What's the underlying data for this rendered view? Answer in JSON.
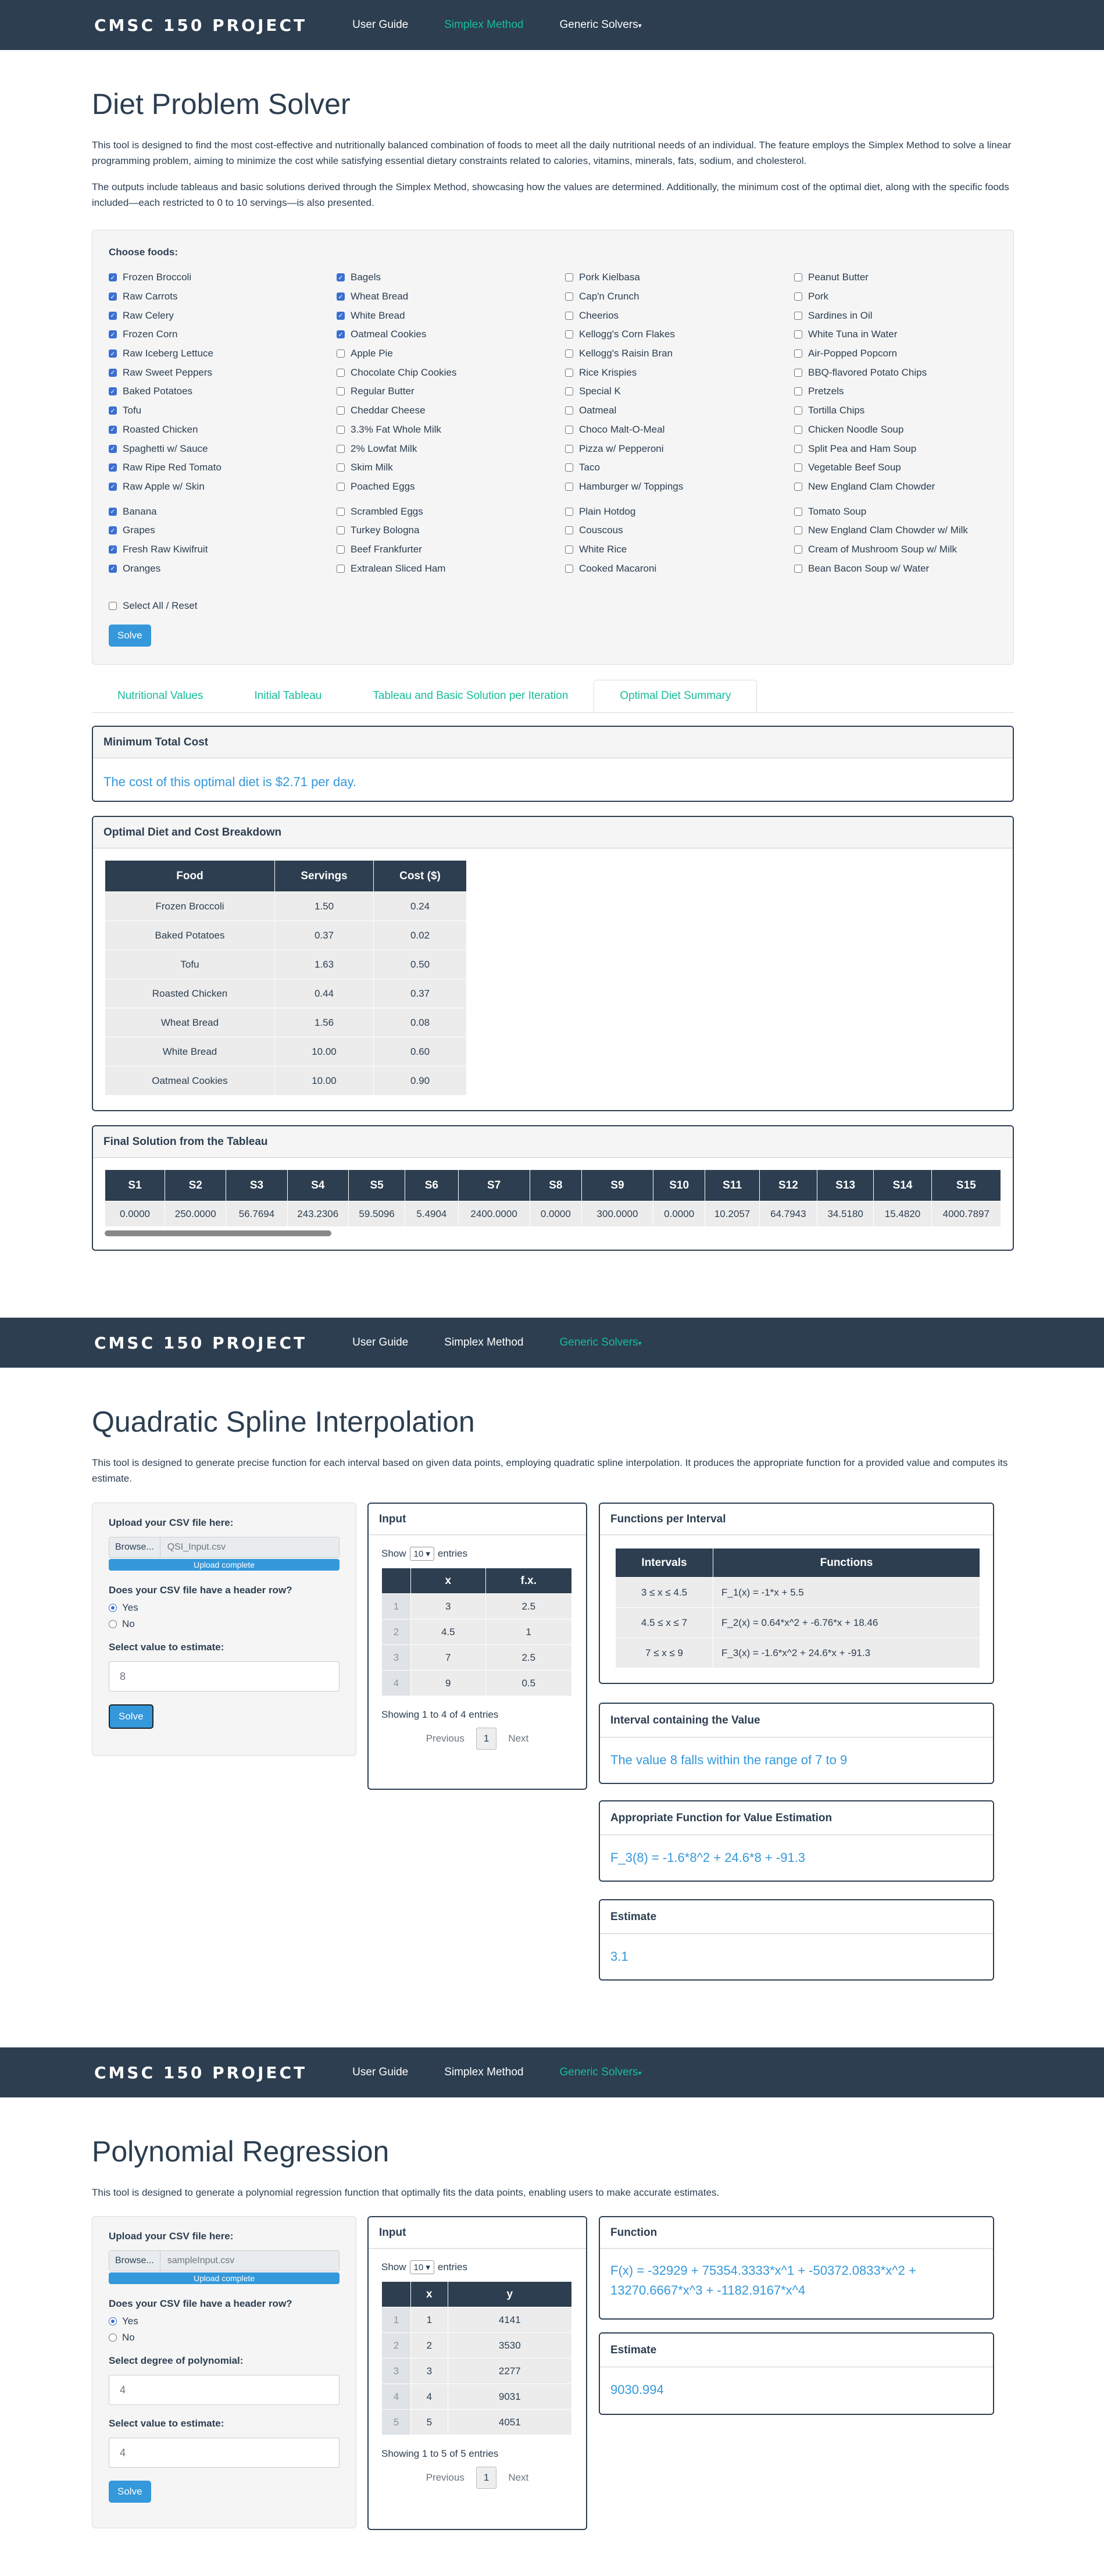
{
  "brand": "CMSC 150 PROJECT",
  "nav": {
    "user_guide": "User Guide",
    "simplex": "Simplex Method",
    "generic": "Generic Solvers"
  },
  "diet": {
    "title": "Diet Problem Solver",
    "p1": "This tool is designed to find the most cost-effective and nutritionally balanced combination of foods to meet all the daily nutritional needs of an individual. The feature employs the Simplex Method to solve a linear programming problem, aiming to minimize the cost while satisfying essential dietary constraints related to calories, vitamins, minerals, fats, sodium, and cholesterol.",
    "p2": "The outputs include tableaus and basic solutions derived through the Simplex Method, showcasing how the values are determined. Additionally, the minimum cost of the optimal diet, along with the specific foods included—each restricted to 0 to 10 servings—is also presented.",
    "choose": "Choose foods:",
    "columns": [
      {
        "items": [
          {
            "label": "Frozen Broccoli",
            "checked": true
          },
          {
            "label": "Raw Carrots",
            "checked": true
          },
          {
            "label": "Raw Celery",
            "checked": true
          },
          {
            "label": "Frozen Corn",
            "checked": true
          },
          {
            "label": "Raw Iceberg Lettuce",
            "checked": true
          },
          {
            "label": "Raw Sweet Peppers",
            "checked": true
          },
          {
            "label": "Baked Potatoes",
            "checked": true
          },
          {
            "label": "Tofu",
            "checked": true
          },
          {
            "label": "Roasted Chicken",
            "checked": true
          },
          {
            "label": "Spaghetti w/ Sauce",
            "checked": true
          },
          {
            "label": "Raw Ripe Red Tomato",
            "checked": true
          },
          {
            "label": "Raw Apple w/ Skin",
            "checked": true
          },
          {
            "label": "Banana",
            "checked": true
          },
          {
            "label": "Grapes",
            "checked": true
          },
          {
            "label": "Fresh Raw Kiwifruit",
            "checked": true
          },
          {
            "label": "Oranges",
            "checked": true
          }
        ]
      },
      {
        "items": [
          {
            "label": "Bagels",
            "checked": true
          },
          {
            "label": "Wheat Bread",
            "checked": true
          },
          {
            "label": "White Bread",
            "checked": true
          },
          {
            "label": "Oatmeal Cookies",
            "checked": true
          },
          {
            "label": "Apple Pie",
            "checked": false
          },
          {
            "label": "Chocolate Chip Cookies",
            "checked": false
          },
          {
            "label": "Regular Butter",
            "checked": false
          },
          {
            "label": "Cheddar Cheese",
            "checked": false
          },
          {
            "label": "3.3% Fat Whole Milk",
            "checked": false
          },
          {
            "label": "2% Lowfat Milk",
            "checked": false
          },
          {
            "label": "Skim Milk",
            "checked": false
          },
          {
            "label": "Poached Eggs",
            "checked": false
          },
          {
            "label": "Scrambled Eggs",
            "checked": false
          },
          {
            "label": "Turkey Bologna",
            "checked": false
          },
          {
            "label": "Beef Frankfurter",
            "checked": false
          },
          {
            "label": "Extralean Sliced Ham",
            "checked": false
          }
        ]
      },
      {
        "items": [
          {
            "label": "Pork Kielbasa",
            "checked": false
          },
          {
            "label": "Cap'n Crunch",
            "checked": false
          },
          {
            "label": "Cheerios",
            "checked": false
          },
          {
            "label": "Kellogg's Corn Flakes",
            "checked": false
          },
          {
            "label": "Kellogg's Raisin Bran",
            "checked": false
          },
          {
            "label": "Rice Krispies",
            "checked": false
          },
          {
            "label": "Special K",
            "checked": false
          },
          {
            "label": "Oatmeal",
            "checked": false
          },
          {
            "label": "Choco Malt-O-Meal",
            "checked": false
          },
          {
            "label": "Pizza w/ Pepperoni",
            "checked": false
          },
          {
            "label": "Taco",
            "checked": false
          },
          {
            "label": "Hamburger w/ Toppings",
            "checked": false
          },
          {
            "label": "Plain Hotdog",
            "checked": false
          },
          {
            "label": "Couscous",
            "checked": false
          },
          {
            "label": "White Rice",
            "checked": false
          },
          {
            "label": "Cooked Macaroni",
            "checked": false
          }
        ]
      },
      {
        "items": [
          {
            "label": "Peanut Butter",
            "checked": false
          },
          {
            "label": "Pork",
            "checked": false
          },
          {
            "label": "Sardines in Oil",
            "checked": false
          },
          {
            "label": "White Tuna in Water",
            "checked": false
          },
          {
            "label": "Air-Popped Popcorn",
            "checked": false
          },
          {
            "label": "BBQ-flavored Potato Chips",
            "checked": false
          },
          {
            "label": "Pretzels",
            "checked": false
          },
          {
            "label": "Tortilla Chips",
            "checked": false
          },
          {
            "label": "Chicken Noodle Soup",
            "checked": false
          },
          {
            "label": "Split Pea and Ham Soup",
            "checked": false
          },
          {
            "label": "Vegetable Beef Soup",
            "checked": false
          },
          {
            "label": "New England Clam Chowder",
            "checked": false
          },
          {
            "label": "Tomato Soup",
            "checked": false
          },
          {
            "label": "New England Clam Chowder w/ Milk",
            "checked": false
          },
          {
            "label": "Cream of Mushroom Soup w/ Milk",
            "checked": false
          },
          {
            "label": "Bean Bacon Soup w/ Water",
            "checked": false
          }
        ]
      }
    ],
    "select_all": "Select All / Reset",
    "solve": "Solve",
    "tabs": [
      "Nutritional Values",
      "Initial Tableau",
      "Tableau and Basic Solution per Iteration",
      "Optimal Diet Summary"
    ],
    "min_cost_title": "Minimum Total Cost",
    "min_cost_text": "The cost of this optimal diet is $2.71 per day.",
    "breakdown_title": "Optimal Diet and Cost Breakdown",
    "breakdown_headers": [
      "Food",
      "Servings",
      "Cost ($)"
    ],
    "breakdown_rows": [
      [
        "Frozen Broccoli",
        "1.50",
        "0.24"
      ],
      [
        "Baked Potatoes",
        "0.37",
        "0.02"
      ],
      [
        "Tofu",
        "1.63",
        "0.50"
      ],
      [
        "Roasted Chicken",
        "0.44",
        "0.37"
      ],
      [
        "Wheat Bread",
        "1.56",
        "0.08"
      ],
      [
        "White Bread",
        "10.00",
        "0.60"
      ],
      [
        "Oatmeal Cookies",
        "10.00",
        "0.90"
      ]
    ],
    "final_title": "Final Solution from the Tableau",
    "final_headers": [
      "S1",
      "S2",
      "S3",
      "S4",
      "S5",
      "S6",
      "S7",
      "S8",
      "S9",
      "S10",
      "S11",
      "S12",
      "S13",
      "S14",
      "S15"
    ],
    "final_values": [
      "0.0000",
      "250.0000",
      "56.7694",
      "243.2306",
      "59.5096",
      "5.4904",
      "2400.0000",
      "0.0000",
      "300.0000",
      "0.0000",
      "10.2057",
      "64.7943",
      "34.5180",
      "15.4820",
      "4000.7897"
    ]
  },
  "qsi": {
    "title": "Quadratic Spline Interpolation",
    "desc": "This tool is designed to generate precise function for each interval based on given data points, employing quadratic spline interpolation. It produces the appropriate function for a provided value and computes its estimate.",
    "upload_label": "Upload your CSV file here:",
    "browse": "Browse...",
    "filename": "QSI_Input.csv",
    "upload_status": "Upload complete",
    "header_q": "Does your CSV file have a header row?",
    "yes": "Yes",
    "no": "No",
    "estimate_label": "Select value to estimate:",
    "estimate_value": "8",
    "solve": "Solve",
    "input_title": "Input",
    "show": "Show",
    "entries_val": "10",
    "entries": "entries",
    "table_headers": [
      "x",
      "f.x."
    ],
    "table_rows": [
      [
        "1",
        "3",
        "2.5"
      ],
      [
        "2",
        "4.5",
        "1"
      ],
      [
        "3",
        "7",
        "2.5"
      ],
      [
        "4",
        "9",
        "0.5"
      ]
    ],
    "showing": "Showing 1 to 4 of 4 entries",
    "previous": "Previous",
    "page": "1",
    "next": "Next",
    "fpi_title": "Functions per Interval",
    "fpi_headers": [
      "Intervals",
      "Functions"
    ],
    "fpi_rows": [
      [
        "3 ≤ x ≤ 4.5",
        "F_1(x) = -1*x + 5.5"
      ],
      [
        "4.5 ≤ x ≤ 7",
        "F_2(x) = 0.64*x^2 + -6.76*x + 18.46"
      ],
      [
        "7 ≤ x ≤ 9",
        "F_3(x) = -1.6*x^2 + 24.6*x + -91.3"
      ]
    ],
    "interval_title": "Interval containing the Value",
    "interval_text": "The value 8 falls within the range of 7 to 9",
    "func_title": "Appropriate Function for Value Estimation",
    "func_text": "F_3(8) = -1.6*8^2 + 24.6*8 + -91.3",
    "estimate_title": "Estimate",
    "estimate_text": "3.1"
  },
  "pr": {
    "title": "Polynomial Regression",
    "desc": "This tool is designed to generate a polynomial regression function that optimally fits the data points, enabling users to make accurate estimates.",
    "upload_label": "Upload your CSV file here:",
    "browse": "Browse...",
    "filename": "sampleInput.csv",
    "upload_status": "Upload complete",
    "header_q": "Does your CSV file have a header row?",
    "yes": "Yes",
    "no": "No",
    "degree_label": "Select degree of polynomial:",
    "degree_value": "4",
    "estimate_label": "Select value to estimate:",
    "estimate_value": "4",
    "solve": "Solve",
    "input_title": "Input",
    "show": "Show",
    "entries_val": "10",
    "entries": "entries",
    "table_headers": [
      "x",
      "y"
    ],
    "table_rows": [
      [
        "1",
        "1",
        "4141"
      ],
      [
        "2",
        "2",
        "3530"
      ],
      [
        "3",
        "3",
        "2277"
      ],
      [
        "4",
        "4",
        "9031"
      ],
      [
        "5",
        "5",
        "4051"
      ]
    ],
    "showing": "Showing 1 to 5 of 5 entries",
    "previous": "Previous",
    "page": "1",
    "next": "Next",
    "function_title": "Function",
    "function_text": "F(x) = -32929 + 75354.3333*x^1 + -50372.0833*x^2 + 13270.6667*x^3 + -1182.9167*x^4",
    "estimate_title": "Estimate",
    "estimate_text": "9030.994"
  }
}
